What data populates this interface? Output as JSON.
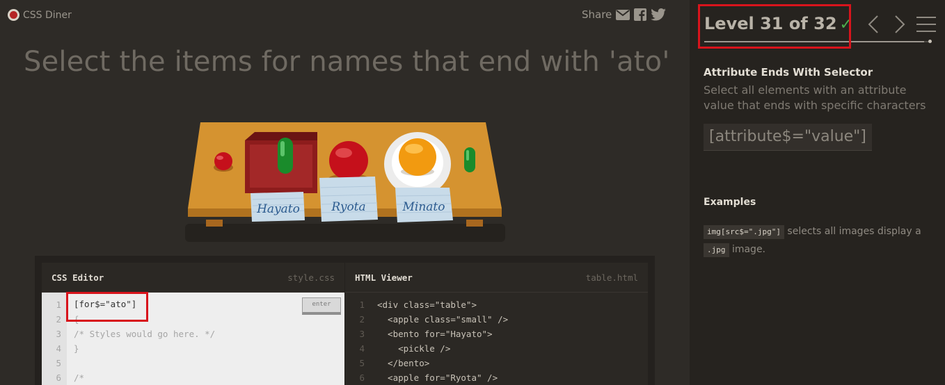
{
  "app": {
    "title": "CSS Diner"
  },
  "header": {
    "share_label": "Share"
  },
  "instruction": "Select the items for names that end with 'ato'",
  "table": {
    "name_cards": [
      "Hayato",
      "Ryota",
      "Minato"
    ]
  },
  "editor": {
    "css": {
      "title": "CSS Editor",
      "file": "style.css",
      "input_value": "[for$=\"ato\"]",
      "enter_label": "enter",
      "line_numbers": [
        "1",
        "2",
        "3",
        "4",
        "5",
        "6"
      ],
      "lines": [
        "",
        "{",
        "/* Styles would go here. */",
        "}",
        "",
        "/*"
      ]
    },
    "html": {
      "title": "HTML Viewer",
      "file": "table.html",
      "line_numbers": [
        "1",
        "2",
        "3",
        "4",
        "5",
        "6"
      ],
      "lines": [
        "<div class=\"table\">",
        "  <apple class=\"small\" />",
        "  <bento for=\"Hayato\">",
        "    <pickle />",
        "  </bento>",
        "  <apple for=\"Ryota\" />"
      ]
    }
  },
  "sidebar": {
    "level": {
      "text": "Level 31 of 32",
      "check": "✓",
      "current": 31,
      "total": 32
    },
    "selector_name": "Attribute Ends With Selector",
    "selector_description": "Select all elements with an attribute value that ends with specific characters",
    "syntax": "[attribute$=\"value\"]",
    "examples_title": "Examples",
    "example": {
      "code1": "img[src$=\".jpg\"]",
      "text1": "selects all images display a",
      "code2": ".jpg",
      "text2": "image."
    }
  },
  "colors": {
    "accent_red": "#d8141c",
    "check_green": "#4cae4c",
    "table_wood": "#d08a2c"
  }
}
